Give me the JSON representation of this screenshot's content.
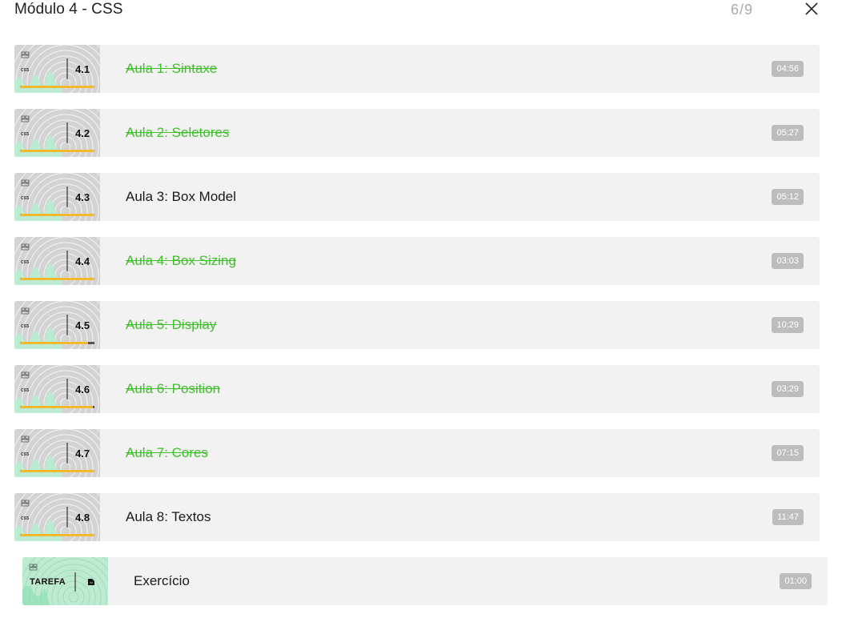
{
  "module": {
    "title": "Módulo 4 - CSS",
    "progress": "6/9"
  },
  "lessons": [
    {
      "number": "4.1",
      "title": "Aula 1: Sintaxe",
      "duration": "04:56",
      "completed": true,
      "watched_fraction": 1.0
    },
    {
      "number": "4.2",
      "title": "Aula 2: Seletores",
      "duration": "05:27",
      "completed": true,
      "watched_fraction": 1.0
    },
    {
      "number": "4.3",
      "title": "Aula 3: Box Model",
      "duration": "05:12",
      "completed": false,
      "watched_fraction": 1.0
    },
    {
      "number": "4.4",
      "title": "Aula 4: Box Sizing",
      "duration": "03:03",
      "completed": true,
      "watched_fraction": 1.0
    },
    {
      "number": "4.5",
      "title": "Aula 5: Display",
      "duration": "10:29",
      "completed": true,
      "watched_fraction": 0.91
    },
    {
      "number": "4.6",
      "title": "Aula 6: Position",
      "duration": "03:29",
      "completed": true,
      "watched_fraction": 0.98
    },
    {
      "number": "4.7",
      "title": "Aula 7: Cores",
      "duration": "07:15",
      "completed": true,
      "watched_fraction": 1.0
    },
    {
      "number": "4.8",
      "title": "Aula 8: Textos",
      "duration": "11:47",
      "completed": false,
      "watched_fraction": 1.0
    }
  ],
  "task": {
    "label": "TAREFA",
    "title": "Exercício",
    "duration": "01:00",
    "completed": false
  },
  "thumb_tag": "CSS",
  "colors": {
    "completed": "#3fbf2a",
    "progress_bar": "#f2b92c",
    "duration_badge": "#bdbdbd",
    "row_background": "#f2f2f3"
  },
  "icons": {
    "close": "close-icon",
    "task": "document-icon"
  }
}
